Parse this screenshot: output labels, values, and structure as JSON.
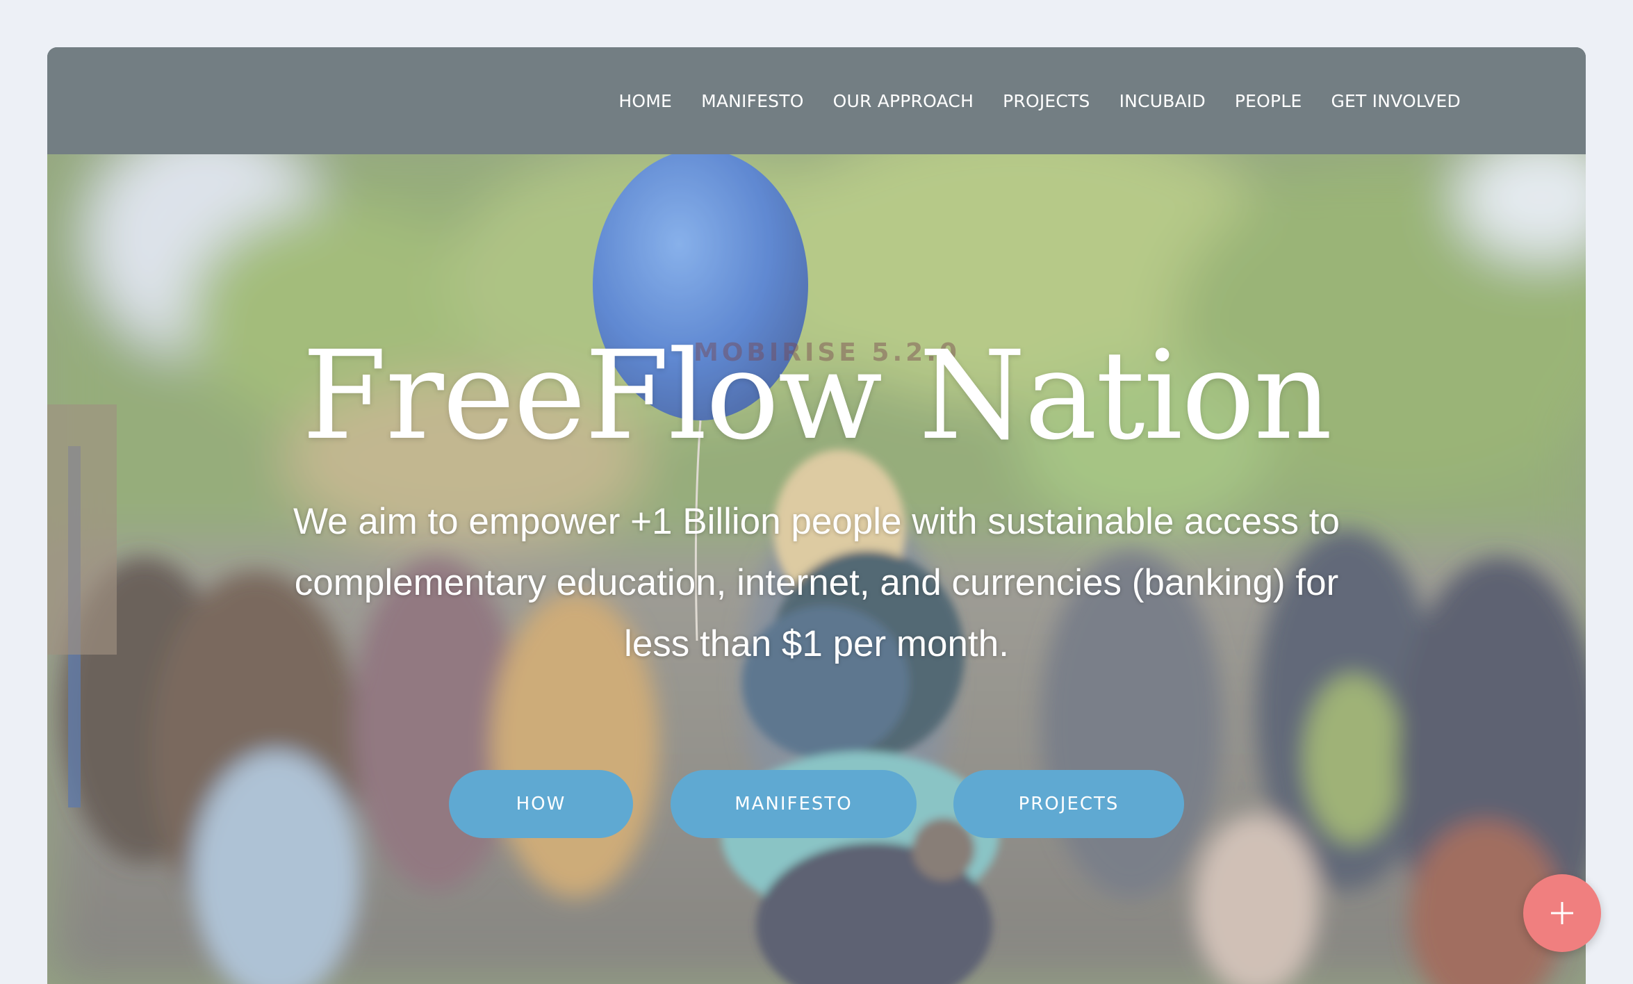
{
  "nav": {
    "items": [
      {
        "label": "HOME"
      },
      {
        "label": "MANIFESTO"
      },
      {
        "label": "OUR APPROACH"
      },
      {
        "label": "PROJECTS"
      },
      {
        "label": "INCUBAID"
      },
      {
        "label": "PEOPLE"
      },
      {
        "label": "GET INVOLVED"
      }
    ]
  },
  "hero": {
    "watermark": "MOBIRISE  5.2.0",
    "title": "FreeFlow Nation",
    "subtitle": "We aim to empower +1 Billion people with sustainable access to complementary education, internet, and currencies (banking) for less than $1 per month.",
    "buttons": [
      {
        "label": "HOW"
      },
      {
        "label": "MANIFESTO"
      },
      {
        "label": "PROJECTS"
      }
    ]
  },
  "fab": {
    "icon": "plus-icon"
  },
  "colors": {
    "page_bg": "#edf0f6",
    "navbar": "#737e83",
    "button": "#5fa9d2",
    "fab": "#f07f7f",
    "text": "#ffffff"
  }
}
